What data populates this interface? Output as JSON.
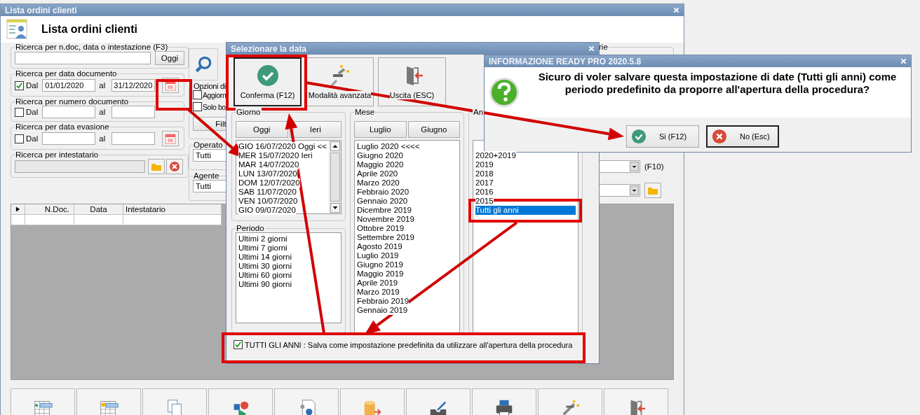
{
  "main_window": {
    "title": "Lista ordini clienti",
    "heading": "Lista ordini clienti"
  },
  "filters": [
    {
      "kind": "text",
      "legend": "Ricerca per n.doc, data o intestazione (F3)",
      "button": "Oggi"
    },
    {
      "kind": "range",
      "legend": "Ricerca per data documento",
      "checked": true,
      "check_label": "Dal",
      "from": "01/01/2020",
      "to_label": "al",
      "to": "31/12/2020",
      "calendar": true
    },
    {
      "kind": "range",
      "legend": "Ricerca per numero documento",
      "checked": false,
      "check_label": "Dal",
      "to_label": "al",
      "calendar": false
    },
    {
      "kind": "range",
      "legend": "Ricerca per data evasione",
      "checked": false,
      "check_label": "Dal",
      "to_label": "al",
      "calendar": true
    },
    {
      "kind": "owner",
      "legend": "Ricerca per intestatario"
    }
  ],
  "options": {
    "legend": "Opzioni di",
    "checks": [
      {
        "label": "Aggiorn",
        "checked": false
      },
      {
        "label": "Solo bo",
        "checked": false
      }
    ],
    "button": "Filt"
  },
  "operator": {
    "legend": "Operato",
    "value": "Tutti"
  },
  "agent": {
    "legend": "Agente",
    "value": "Tutti"
  },
  "right_panel": {
    "legend": "rie",
    "shortcut": "(F10)"
  },
  "table": {
    "columns": [
      "N.Doc.",
      "Data",
      "Intestatario"
    ]
  },
  "date_dialog": {
    "title": "Selezionare la data",
    "actions": [
      {
        "kind": "confirm",
        "label": "Conferma (F12)"
      },
      {
        "kind": "advanced",
        "label": "Modalità avanzata"
      },
      {
        "kind": "exit",
        "label": "Uscita (ESC)"
      }
    ],
    "day": {
      "legend": "Giorno",
      "buttons": [
        "Oggi",
        "Ieri"
      ],
      "items": [
        "GIO 16/07/2020 Oggi <<",
        "MER 15/07/2020 Ieri",
        "MAR 14/07/2020",
        "LUN 13/07/2020",
        "DOM 12/07/2020",
        "SAB 11/07/2020",
        "VEN 10/07/2020",
        "GIO 09/07/2020"
      ]
    },
    "period": {
      "legend": "Periodo",
      "items": [
        "Ultimi 2 giorni",
        "Ultimi 7 giorni",
        "Ultimi 14 giorni",
        "Ultimi 30 giorni",
        "Ultimi 60 giorni",
        "Ultimi 90 giorni"
      ]
    },
    "month": {
      "legend": "Mese",
      "buttons": [
        "Luglio",
        "Giugno"
      ],
      "items": [
        "Luglio 2020 <<<<",
        "Giugno 2020",
        "Maggio 2020",
        "Aprile 2020",
        "Marzo 2020",
        "Febbraio 2020",
        "Gennaio 2020",
        "Dicembre 2019",
        "Novembre 2019",
        "Ottobre 2019",
        "Settembre 2019",
        "Agosto 2019",
        "Luglio 2019",
        "Giugno 2019",
        "Maggio 2019",
        "Aprile 2019",
        "Marzo 2019",
        "Febbraio 2019",
        "Gennaio 2019"
      ]
    },
    "year": {
      "legend": "An",
      "items": [
        {
          "label": "2020+2019",
          "selected": false
        },
        {
          "label": "2019",
          "selected": false
        },
        {
          "label": "2018",
          "selected": false
        },
        {
          "label": "2017",
          "selected": false
        },
        {
          "label": "2016",
          "selected": false
        },
        {
          "label": "2015",
          "selected": false
        },
        {
          "label": "Tutti gli anni",
          "selected": true
        }
      ]
    },
    "default_option": {
      "checked": true,
      "label": "TUTTI GLI ANNI : Salva come impostazione predefinita da utilizzare all'apertura della procedura"
    }
  },
  "info_dialog": {
    "title": "INFORMAZIONE READY PRO 2020.5.8",
    "message": "Sicuro di voler salvare questa impostazione di date (Tutti gli anni) come periodo predefinito da proporre all'apertura della procedura?",
    "buttons": [
      {
        "kind": "yes",
        "label": "Si (F12)"
      },
      {
        "kind": "no",
        "label": "No (Esc)"
      }
    ]
  }
}
